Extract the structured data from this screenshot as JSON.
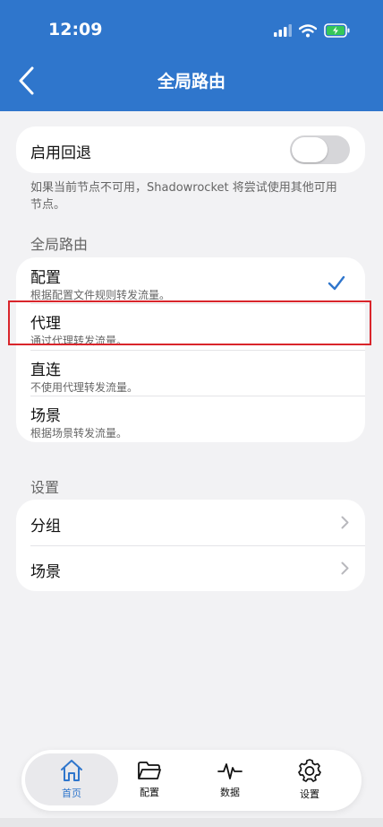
{
  "status_bar": {
    "time": "12:09"
  },
  "nav": {
    "title": "全局路由"
  },
  "fallback": {
    "label": "启用回退",
    "enabled": false,
    "footnote": "如果当前节点不可用，Shadowrocket 将尝试使用其他可用节点。"
  },
  "routing": {
    "header": "全局路由",
    "options": [
      {
        "title": "配置",
        "desc": "根据配置文件规则转发流量。",
        "selected": true
      },
      {
        "title": "代理",
        "desc": "通过代理转发流量。",
        "selected": false
      },
      {
        "title": "直连",
        "desc": "不使用代理转发流量。",
        "selected": false
      },
      {
        "title": "场景",
        "desc": "根据场景转发流量。",
        "selected": false
      }
    ]
  },
  "settings": {
    "header": "设置",
    "items": [
      {
        "label": "分组"
      },
      {
        "label": "场景"
      }
    ]
  },
  "tabs": [
    {
      "label": "首页",
      "icon": "home-icon",
      "active": true
    },
    {
      "label": "配置",
      "icon": "folder-icon",
      "active": false
    },
    {
      "label": "数据",
      "icon": "pulse-icon",
      "active": false
    },
    {
      "label": "设置",
      "icon": "gear-icon",
      "active": false
    }
  ],
  "colors": {
    "accent": "#2f76cc",
    "highlight": "#d9252b"
  }
}
